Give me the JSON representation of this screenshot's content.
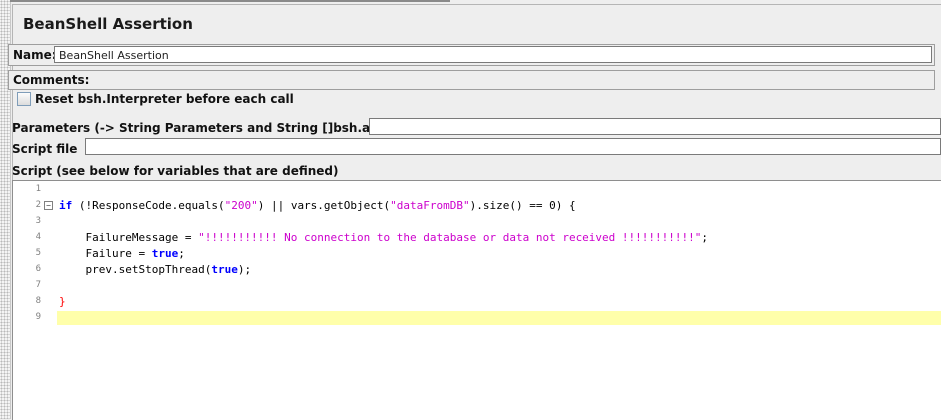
{
  "panel": {
    "title": "BeanShell Assertion",
    "name_label": "Name:",
    "name_value": "BeanShell Assertion",
    "comments_label": "Comments:",
    "reset_label": "Reset bsh.Interpreter before each call",
    "parameters_label": "Parameters (-> String Parameters and String []bsh.args)",
    "parameters_value": "",
    "script_file_label": "Script file",
    "script_file_value": "",
    "script_label": "Script (see below for variables that are defined)"
  },
  "editor": {
    "line_numbers": [
      "1",
      "2",
      "3",
      "4",
      "5",
      "6",
      "7",
      "8",
      "9"
    ],
    "fold_marker": "−",
    "code": {
      "l2_if": "if",
      "l2_a": " (!ResponseCode.equals(",
      "l2_s1": "\"200\"",
      "l2_b": ") || vars.getObject(",
      "l2_s2": "\"dataFromDB\"",
      "l2_c": ").size() == 0) {",
      "l4_a": "    FailureMessage = ",
      "l4_s": "\"!!!!!!!!!!! No connection to the database or data not received !!!!!!!!!!!\"",
      "l4_b": ";",
      "l5_a": "    Failure = ",
      "l5_kw": "true",
      "l5_b": ";",
      "l6_a": "    prev.setStopThread(",
      "l6_kw": "true",
      "l6_b": ");",
      "l8": "}"
    }
  },
  "colors": {
    "keyword": "#0000ff",
    "string": "#cc00cc",
    "brace": "#ff0000",
    "current_line": "#ffffaa"
  }
}
